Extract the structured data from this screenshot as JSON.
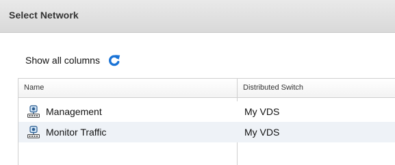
{
  "dialog": {
    "title": "Select Network"
  },
  "toolbar": {
    "show_all_columns_label": "Show all columns",
    "refresh_icon": "refresh-icon",
    "accent_color": "#1a73d6"
  },
  "table": {
    "columns": [
      {
        "label": "Name"
      },
      {
        "label": "Distributed Switch"
      }
    ],
    "rows": [
      {
        "name": "Management",
        "switch": "My VDS",
        "icon": "network-portgroup-icon"
      },
      {
        "name": "Monitor Traffic",
        "switch": "My VDS",
        "icon": "network-portgroup-icon"
      }
    ]
  }
}
